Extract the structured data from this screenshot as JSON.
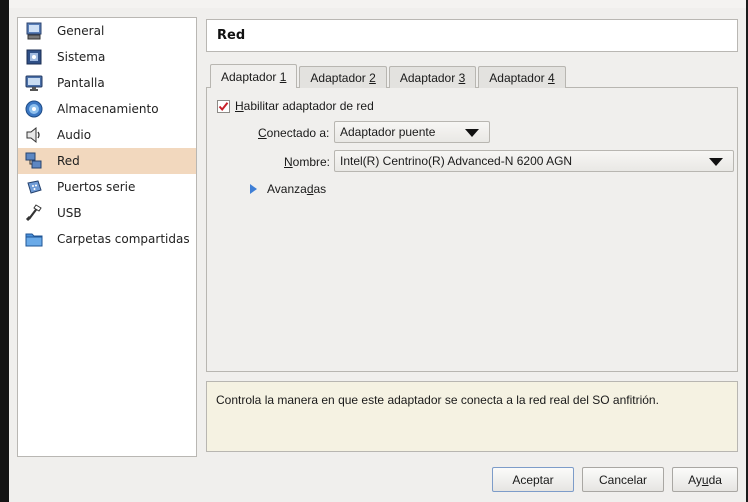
{
  "sidebar": {
    "items": [
      {
        "label": "General",
        "icon": "general-icon"
      },
      {
        "label": "Sistema",
        "icon": "chip-icon"
      },
      {
        "label": "Pantalla",
        "icon": "monitor-icon"
      },
      {
        "label": "Almacenamiento",
        "icon": "disk-icon"
      },
      {
        "label": "Audio",
        "icon": "speaker-icon"
      },
      {
        "label": "Red",
        "icon": "network-icon",
        "selected": true
      },
      {
        "label": "Puertos serie",
        "icon": "serial-port-icon"
      },
      {
        "label": "USB",
        "icon": "usb-icon"
      },
      {
        "label": "Carpetas compartidas",
        "icon": "folder-icon"
      }
    ]
  },
  "header": {
    "title": "Red"
  },
  "tabs": [
    {
      "pre": "Adaptador ",
      "key": "1"
    },
    {
      "pre": "Adaptador ",
      "key": "2"
    },
    {
      "pre": "Adaptador ",
      "key": "3"
    },
    {
      "pre": "Adaptador ",
      "key": "4"
    }
  ],
  "adapter": {
    "enable_key": "H",
    "enable_rest": "abilitar adaptador de red",
    "enable_checked": true,
    "attached_key": "C",
    "attached_rest": "onectado a:",
    "attached_value": "Adaptador puente",
    "name_key": "N",
    "name_rest": "ombre:",
    "name_value": "Intel(R) Centrino(R) Advanced-N 6200 AGN",
    "advanced_pre": "Avanza",
    "advanced_key": "d",
    "advanced_post": "as"
  },
  "info": {
    "text": "Controla la manera en que este adaptador se conecta a la red real del SO anfitrión."
  },
  "buttons": {
    "ok": "Aceptar",
    "cancel": "Cancelar",
    "help_pre": "Ay",
    "help_key": "u",
    "help_post": "da"
  },
  "colors": {
    "selection": "#f2d8be",
    "info_bg": "#f5f2e2",
    "check": "#c8202a",
    "expander": "#3f7fd6"
  }
}
